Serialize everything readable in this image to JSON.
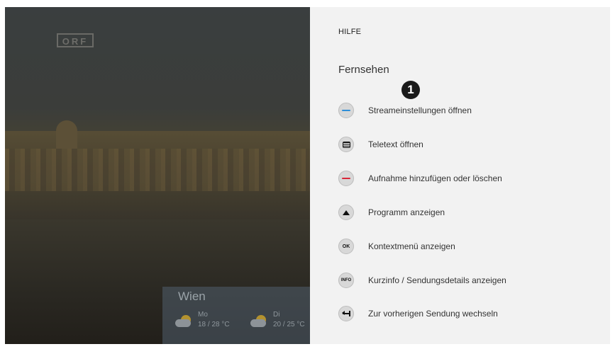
{
  "video": {
    "channel_logo": "ORF",
    "weather": {
      "city": "Wien",
      "days": [
        {
          "name": "Mo",
          "temp": "18 / 28 °C"
        },
        {
          "name": "Di",
          "temp": "20 / 25 °C"
        }
      ]
    }
  },
  "help": {
    "title": "HILFE",
    "section": "Fernsehen",
    "marker": "1",
    "rows": [
      {
        "key": "blue-button",
        "color": "#2f8fd8",
        "label": "Streameinstellungen öffnen"
      },
      {
        "key": "teletext-button",
        "label": "Teletext öffnen"
      },
      {
        "key": "red-button",
        "color": "#d9283a",
        "label": "Aufnahme hinzufügen oder löschen"
      },
      {
        "key": "up-button",
        "label": "Programm anzeigen"
      },
      {
        "key": "ok-button",
        "key_text": "OK",
        "label": "Kontextmenü anzeigen"
      },
      {
        "key": "info-button",
        "key_text": "INFO",
        "label": "Kurzinfo / Sendungsdetails anzeigen"
      },
      {
        "key": "back-button",
        "label": "Zur vorherigen Sendung wechseln"
      }
    ]
  }
}
